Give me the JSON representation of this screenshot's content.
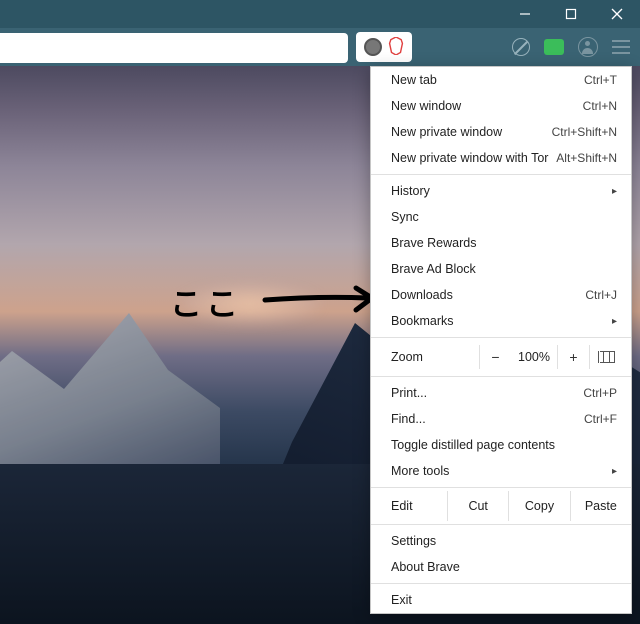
{
  "menu": {
    "items_top": [
      {
        "label": "New tab",
        "shortcut": "Ctrl+T"
      },
      {
        "label": "New window",
        "shortcut": "Ctrl+N"
      },
      {
        "label": "New private window",
        "shortcut": "Ctrl+Shift+N"
      },
      {
        "label": "New private window with Tor",
        "shortcut": "Alt+Shift+N"
      }
    ],
    "items_history": [
      {
        "label": "History",
        "submenu": true
      },
      {
        "label": "Sync"
      },
      {
        "label": "Brave Rewards"
      },
      {
        "label": "Brave Ad Block"
      },
      {
        "label": "Downloads",
        "shortcut": "Ctrl+J"
      },
      {
        "label": "Bookmarks",
        "submenu": true
      }
    ],
    "zoom": {
      "label": "Zoom",
      "minus": "−",
      "value": "100%",
      "plus": "+"
    },
    "items_tools": [
      {
        "label": "Print...",
        "shortcut": "Ctrl+P"
      },
      {
        "label": "Find...",
        "shortcut": "Ctrl+F"
      },
      {
        "label": "Toggle distilled page contents"
      },
      {
        "label": "More tools",
        "submenu": true
      }
    ],
    "edit": {
      "label": "Edit",
      "cut": "Cut",
      "copy": "Copy",
      "paste": "Paste"
    },
    "items_bottom": [
      {
        "label": "Settings"
      },
      {
        "label": "About Brave"
      }
    ],
    "exit": {
      "label": "Exit"
    }
  },
  "annotation": {
    "text": "ここ"
  }
}
